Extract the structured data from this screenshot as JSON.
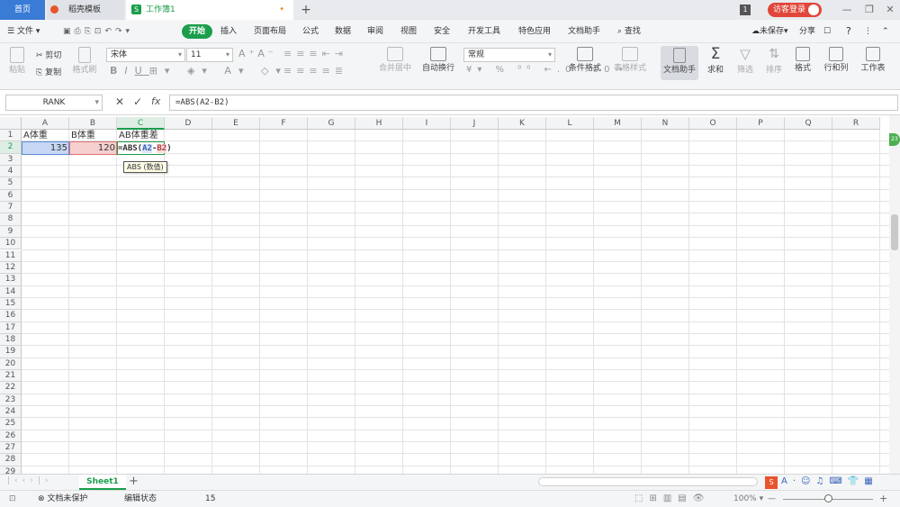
{
  "tabs": {
    "home": "首页",
    "template": "稻壳模板",
    "doc": "工作簿1",
    "doc_modified": "•",
    "new_tab": "+"
  },
  "titlebar": {
    "window_count": "1",
    "login": "访客登录"
  },
  "menu": {
    "file": "文件",
    "items": [
      "开始",
      "插入",
      "页面布局",
      "公式",
      "数据",
      "审阅",
      "视图",
      "安全",
      "开发工具",
      "特色应用",
      "文档助手"
    ],
    "search": "查找",
    "unsaved": "未保存",
    "share": "分享",
    "help": "?"
  },
  "ribbon": {
    "paste": "粘贴",
    "cut": "剪切",
    "copy": "复制",
    "format_painter": "格式刷",
    "font_name": "宋体",
    "font_size": "11",
    "merge_center": "合并居中",
    "wrap_text": "自动换行",
    "number_format": "常规",
    "cond_format": "条件格式",
    "table_style": "表格样式",
    "doc_assistant": "文档助手",
    "sum": "求和",
    "filter": "筛选",
    "sort": "排序",
    "format": "格式",
    "row_col": "行和列",
    "worksheet": "工作表"
  },
  "formula_bar": {
    "name_box": "RANK",
    "fx": "fx",
    "formula": "=ABS(A2-B2)"
  },
  "grid": {
    "columns": [
      "A",
      "B",
      "C",
      "D",
      "E",
      "F",
      "G",
      "H",
      "I",
      "J",
      "K",
      "L",
      "M",
      "N",
      "O",
      "P",
      "Q",
      "R"
    ],
    "rows": [
      "1",
      "2",
      "3",
      "4",
      "5",
      "6",
      "7",
      "8",
      "9",
      "10",
      "11",
      "12",
      "13",
      "14",
      "15",
      "16",
      "17",
      "18",
      "19",
      "20",
      "21",
      "22",
      "23",
      "24",
      "25",
      "26",
      "27",
      "28",
      "29"
    ],
    "a1": "A体重",
    "b1": "B体重",
    "c1": "AB体重差",
    "a2": "135",
    "b2": "120",
    "c2_prefix": "=ABS(",
    "c2_ref_a": "A2",
    "c2_minus": "-",
    "c2_ref_b": "B2",
    "c2_suffix": ")",
    "tooltip": "ABS (数值)"
  },
  "sheets": {
    "active": "Sheet1",
    "add": "+"
  },
  "status": {
    "protect": "文档未保护",
    "mode": "编辑状态",
    "value": "15",
    "zoom": "100%"
  },
  "colors": {
    "accent_green": "#1b9e4b",
    "home_tab": "#3a7bd5",
    "login": "#e0463a",
    "ref_a_fill": "#c7d7f3",
    "ref_b_fill": "#f6cfcf"
  }
}
